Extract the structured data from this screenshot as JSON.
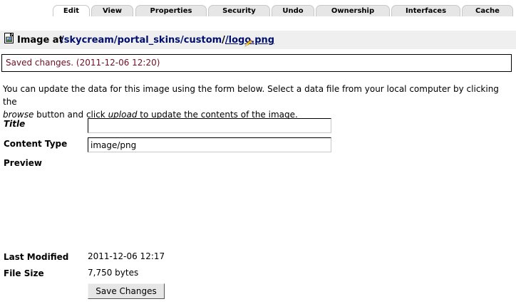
{
  "tabs": [
    {
      "label": "Edit",
      "active": true
    },
    {
      "label": "View"
    },
    {
      "label": "Properties"
    },
    {
      "label": "Security"
    },
    {
      "label": "Undo"
    },
    {
      "label": "Ownership"
    },
    {
      "label": "Interfaces"
    },
    {
      "label": "Cache"
    }
  ],
  "header": {
    "label": "Image at",
    "path": [
      "/skycream",
      "/portal_skins",
      "/custom",
      "/logo.png"
    ]
  },
  "message": "Saved changes. (2011-12-06 12:20)",
  "intro": {
    "line1": "You can update the data for this image using the form below. Select a data file from your local computer by clicking the",
    "browse": "browse",
    "mid": " button and click ",
    "upload": "upload",
    "end": " to update the contents of the image."
  },
  "form": {
    "title_label": "Title",
    "title_value": "",
    "content_type_label": "Content Type",
    "content_type_value": "image/png",
    "preview_label": "Preview",
    "last_modified_label": "Last Modified",
    "last_modified_value": "2011-12-06 12:17",
    "file_size_label": "File Size",
    "file_size_value": "7,750 bytes",
    "save_label": "Save Changes"
  },
  "colors": {
    "link": "#000f6b",
    "message_text": "#6d1026",
    "tab_bg": "#e6e6e6",
    "header_bg": "#efefef"
  }
}
